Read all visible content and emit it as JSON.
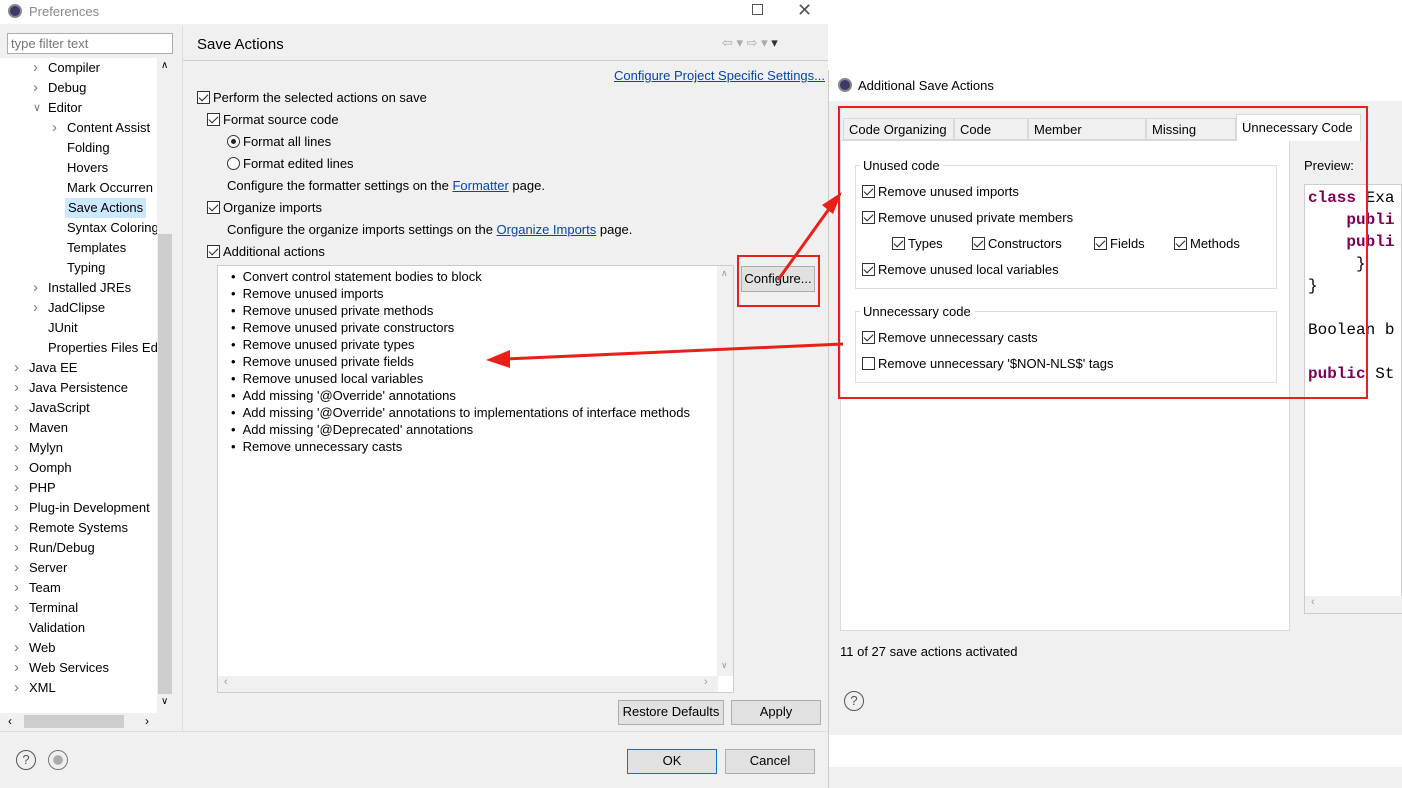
{
  "window": {
    "title": "Preferences",
    "filter_placeholder": "type filter text"
  },
  "tree": [
    {
      "label": "Compiler",
      "level": 1,
      "chevron": "right"
    },
    {
      "label": "Debug",
      "level": 1,
      "chevron": "right"
    },
    {
      "label": "Editor",
      "level": 1,
      "chevron": "down"
    },
    {
      "label": "Content Assist",
      "level": 2,
      "chevron": "right"
    },
    {
      "label": "Folding",
      "level": 2,
      "chevron": ""
    },
    {
      "label": "Hovers",
      "level": 2,
      "chevron": ""
    },
    {
      "label": "Mark Occurren",
      "level": 2,
      "chevron": ""
    },
    {
      "label": "Save Actions",
      "level": 2,
      "chevron": "",
      "selected": true
    },
    {
      "label": "Syntax Coloring",
      "level": 2,
      "chevron": ""
    },
    {
      "label": "Templates",
      "level": 2,
      "chevron": ""
    },
    {
      "label": "Typing",
      "level": 2,
      "chevron": ""
    },
    {
      "label": "Installed JREs",
      "level": 1,
      "chevron": "right"
    },
    {
      "label": "JadClipse",
      "level": 1,
      "chevron": "right"
    },
    {
      "label": "JUnit",
      "level": 1,
      "chevron": ""
    },
    {
      "label": "Properties Files Ed",
      "level": 1,
      "chevron": ""
    },
    {
      "label": "Java EE",
      "level": 0,
      "chevron": "right"
    },
    {
      "label": "Java Persistence",
      "level": 0,
      "chevron": "right"
    },
    {
      "label": "JavaScript",
      "level": 0,
      "chevron": "right"
    },
    {
      "label": "Maven",
      "level": 0,
      "chevron": "right"
    },
    {
      "label": "Mylyn",
      "level": 0,
      "chevron": "right"
    },
    {
      "label": "Oomph",
      "level": 0,
      "chevron": "right"
    },
    {
      "label": "PHP",
      "level": 0,
      "chevron": "right"
    },
    {
      "label": "Plug-in Development",
      "level": 0,
      "chevron": "right"
    },
    {
      "label": "Remote Systems",
      "level": 0,
      "chevron": "right"
    },
    {
      "label": "Run/Debug",
      "level": 0,
      "chevron": "right"
    },
    {
      "label": "Server",
      "level": 0,
      "chevron": "right"
    },
    {
      "label": "Team",
      "level": 0,
      "chevron": "right"
    },
    {
      "label": "Terminal",
      "level": 0,
      "chevron": "right"
    },
    {
      "label": "Validation",
      "level": 0,
      "chevron": ""
    },
    {
      "label": "Web",
      "level": 0,
      "chevron": "right"
    },
    {
      "label": "Web Services",
      "level": 0,
      "chevron": "right"
    },
    {
      "label": "XML",
      "level": 0,
      "chevron": "right"
    }
  ],
  "page": {
    "title": "Save Actions",
    "project_link": "Configure Project Specific Settings...",
    "perform": "Perform the selected actions on save",
    "format_source": "Format source code",
    "format_all": "Format all lines",
    "format_edited": "Format edited lines",
    "formatter_pre": "Configure the formatter settings on the ",
    "formatter_link": "Formatter",
    "formatter_post": " page.",
    "organize": "Organize imports",
    "organize_pre": "Configure the organize imports settings on the ",
    "organize_link": "Organize Imports",
    "organize_post": " page.",
    "additional": "Additional actions",
    "configure": "Configure...",
    "actions": [
      "Convert control statement bodies to block",
      "Remove unused imports",
      "Remove unused private methods",
      "Remove unused private constructors",
      "Remove unused private types",
      "Remove unused private fields",
      "Remove unused local variables",
      "Add missing '@Override' annotations",
      "Add missing '@Override' annotations to implementations of interface methods",
      "Add missing '@Deprecated' annotations",
      "Remove unnecessary casts"
    ],
    "restore": "Restore Defaults",
    "apply": "Apply",
    "ok": "OK",
    "cancel": "Cancel"
  },
  "dialog": {
    "title": "Additional Save Actions",
    "tabs": [
      "Code Organizing",
      "Code Style",
      "Member Accesses",
      "Missing Code",
      "Unnecessary Code"
    ],
    "active_tab": "Unnecessary Code",
    "unused_group": "Unused code",
    "remove_imports": "Remove unused imports",
    "remove_private": "Remove unused private members",
    "types": "Types",
    "constructors": "Constructors",
    "fields": "Fields",
    "methods": "Methods",
    "remove_locals": "Remove unused local variables",
    "unnecessary_group": "Unnecessary code",
    "remove_casts": "Remove unnecessary casts",
    "remove_nls": "Remove unnecessary '$NON-NLS$' tags",
    "preview_label": "Preview:",
    "preview": {
      "l1a": "class",
      "l1b": " Exa",
      "l2": "publi",
      "l3": "publi",
      "l4": "}",
      "l5": "}",
      "l6": "Boolean b",
      "l7a": "public",
      "l7b": " St"
    },
    "status": "11 of 27 save actions activated"
  },
  "colors": {
    "annotation": "#e8201a",
    "keyword": "#7f0055",
    "link": "#0645ad",
    "selection": "#cce8ff"
  }
}
